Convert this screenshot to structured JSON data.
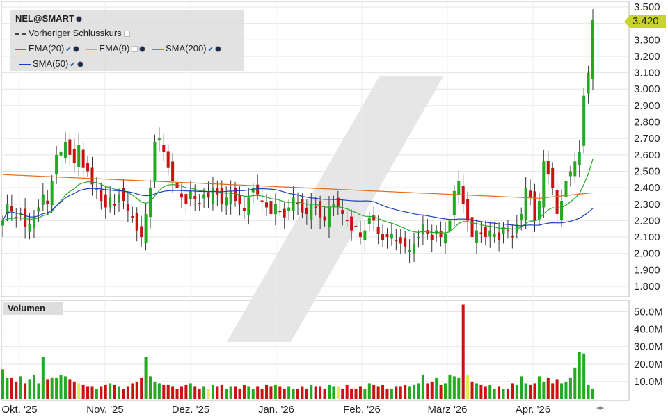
{
  "legend": {
    "symbol": "NEL@SMART",
    "prev_close_label": "Vorheriger Schlusskurs",
    "ema20_label": "EMA(20)",
    "ema9_label": "EMA(9)",
    "sma200_label": "SMA(200)",
    "sma50_label": "SMA(50)"
  },
  "volume_label": "Volumen",
  "last_price": "3.420",
  "colors": {
    "up": "#22aa22",
    "down": "#cc1111",
    "neutral": "#e8e84a",
    "ema20": "#22aa22",
    "ema9": "#e3a455",
    "sma200": "#e06a1a",
    "sma50": "#1a3fbf",
    "price_tag": "#c9d42c",
    "panel": "#dddddd"
  },
  "chart_data": {
    "type": "candlestick",
    "price_axis_labels": [
      "3.500",
      "3.400",
      "3.300",
      "3.200",
      "3.100",
      "3.000",
      "2.900",
      "2.800",
      "2.700",
      "2.600",
      "2.500",
      "2.400",
      "2.300",
      "2.200",
      "2.100",
      "2.000",
      "1.900",
      "1.800"
    ],
    "volume_axis_labels": [
      "50.0M",
      "40.0M",
      "30.0M",
      "20.0M",
      "10.0M"
    ],
    "x_labels": [
      "Okt. '25",
      "Nov. '25",
      "Dez. '25",
      "Jan. '26",
      "Feb. '26",
      "März '26",
      "Apr. '26"
    ],
    "ylim": [
      1.72,
      3.52
    ],
    "vol_max": 55,
    "x_start_label": "Okt. '25",
    "x_end_label": "Apr. '26",
    "ohlc_close": [
      2.2,
      2.3,
      2.26,
      2.22,
      2.24,
      2.16,
      2.18,
      2.22,
      2.28,
      2.36,
      2.3,
      2.44,
      2.6,
      2.62,
      2.68,
      2.6,
      2.55,
      2.66,
      2.52,
      2.5,
      2.42,
      2.4,
      2.32,
      2.28,
      2.34,
      2.3,
      2.36,
      2.32,
      2.26,
      2.22,
      2.14,
      2.1,
      2.24,
      2.4,
      2.68,
      2.7,
      2.62,
      2.52,
      2.44,
      2.4,
      2.34,
      2.3,
      2.38,
      2.33,
      2.3,
      2.36,
      2.34,
      2.4,
      2.36,
      2.3,
      2.34,
      2.38,
      2.32,
      2.3,
      2.26,
      2.34,
      2.4,
      2.36,
      2.32,
      2.28,
      2.24,
      2.3,
      2.26,
      2.22,
      2.28,
      2.34,
      2.3,
      2.25,
      2.24,
      2.3,
      2.28,
      2.22,
      2.2,
      2.28,
      2.3,
      2.28,
      2.24,
      2.2,
      2.14,
      2.16,
      2.1,
      2.14,
      2.22,
      2.2,
      2.12,
      2.08,
      2.1,
      2.12,
      2.08,
      2.06,
      2.04,
      2.02,
      2.06,
      2.1,
      2.18,
      2.12,
      2.08,
      2.14,
      2.1,
      2.12,
      2.2,
      2.38,
      2.44,
      2.3,
      2.2,
      2.1,
      2.14,
      2.12,
      2.1,
      2.14,
      2.12,
      2.08,
      2.16,
      2.14,
      2.1,
      2.18,
      2.24,
      2.4,
      2.34,
      2.2,
      2.32,
      2.56,
      2.48,
      2.4,
      2.24,
      2.32,
      2.44,
      2.5,
      2.56,
      2.62,
      2.96,
      3.1,
      3.42
    ],
    "volume_m": [
      17,
      12,
      12,
      10,
      13,
      9,
      11,
      14,
      9,
      24,
      11,
      12,
      12,
      14,
      13,
      11,
      10,
      9,
      8,
      7,
      7,
      6,
      7,
      8,
      9,
      8,
      7,
      6,
      7,
      9,
      10,
      12,
      24,
      13,
      10,
      9,
      8,
      8,
      7,
      6,
      7,
      8,
      9,
      7,
      6,
      7,
      6,
      8,
      7,
      8,
      6,
      7,
      7,
      6,
      8,
      7,
      6,
      7,
      6,
      8,
      7,
      8,
      7,
      6,
      7,
      6,
      6,
      7,
      6,
      8,
      7,
      7,
      6,
      8,
      7,
      7,
      6,
      8,
      6,
      6,
      7,
      6,
      9,
      8,
      7,
      8,
      6,
      6,
      7,
      7,
      8,
      7,
      8,
      9,
      14,
      9,
      10,
      12,
      8,
      9,
      14,
      13,
      12,
      54,
      14,
      10,
      9,
      8,
      7,
      8,
      6,
      7,
      6,
      6,
      9,
      8,
      13,
      9,
      8,
      9,
      13,
      10,
      12,
      9,
      11,
      9,
      10,
      12,
      18,
      27,
      26,
      8,
      6,
      7
    ]
  }
}
